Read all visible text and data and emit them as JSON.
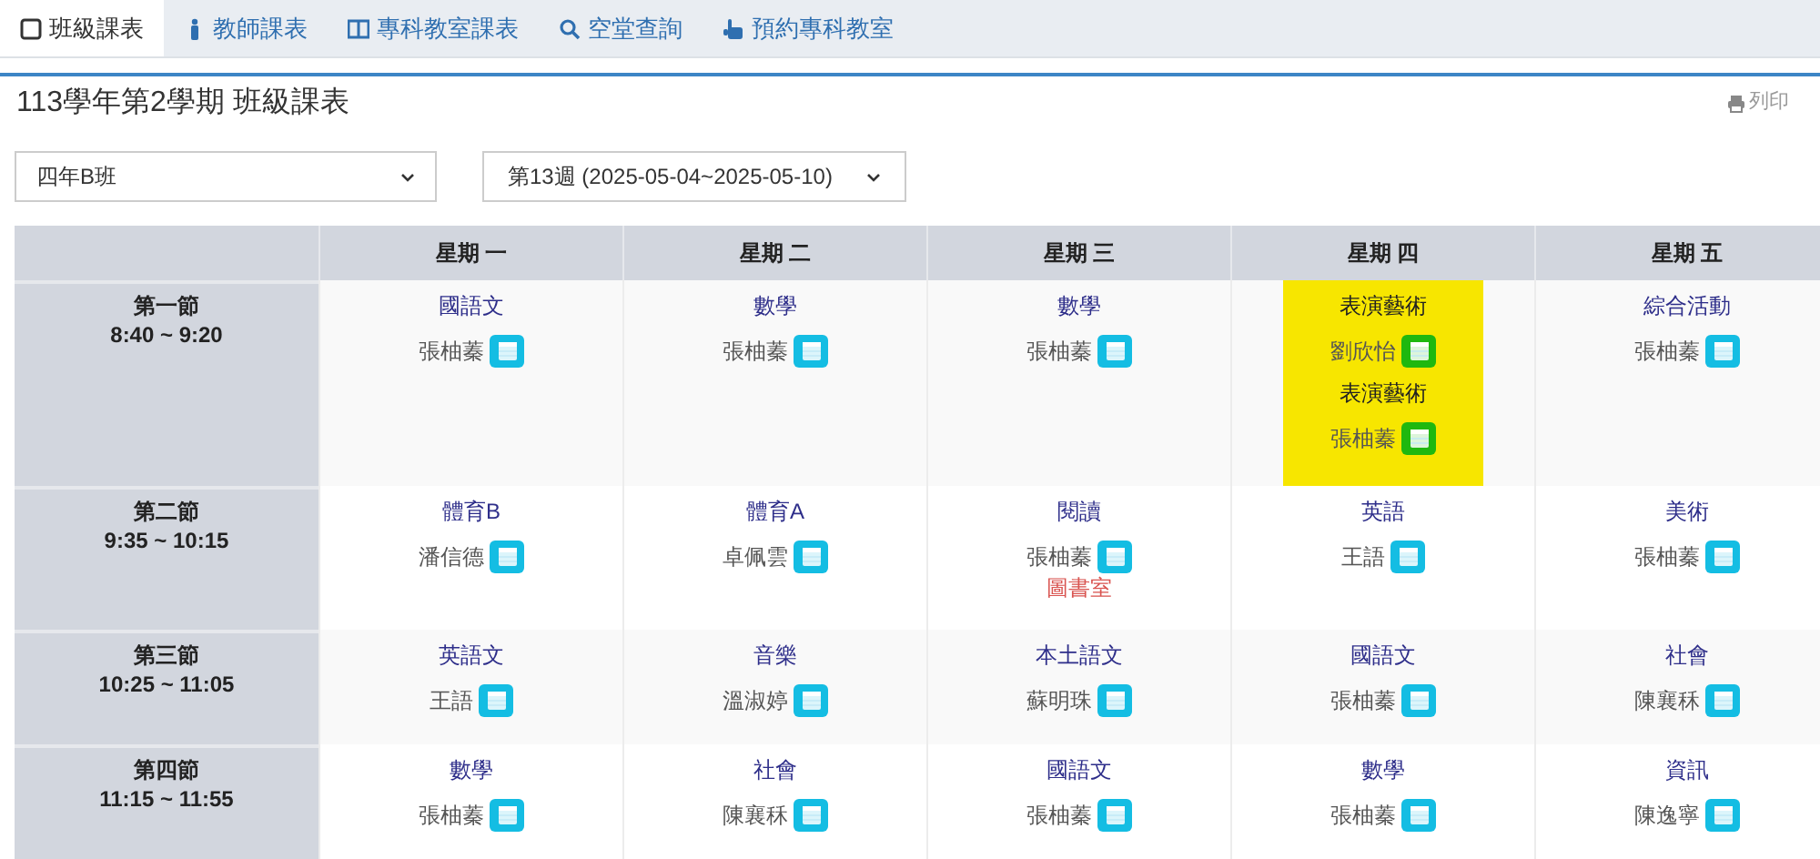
{
  "tabs": [
    {
      "label": "班級課表",
      "selected": true
    },
    {
      "label": "教師課表",
      "selected": false
    },
    {
      "label": "專科教室課表",
      "selected": false
    },
    {
      "label": "空堂查詢",
      "selected": false
    },
    {
      "label": "預約專科教室",
      "selected": false
    }
  ],
  "title": "113學年第2學期 班級課表",
  "print_button": "列印",
  "class_select": {
    "value": "四年B班"
  },
  "week_select": {
    "value": "第13週 (2025-05-04~2025-05-10)"
  },
  "table": {
    "columns": [
      "星期 一",
      "星期 二",
      "星期 三",
      "星期 四",
      "星期 五"
    ],
    "rows": [
      {
        "period": "第一節",
        "time": "8:40 ~ 9:20",
        "cells": [
          {
            "highlighted": false,
            "entries": [
              {
                "subject": "國語文",
                "teacher": "張柚蓁",
                "color": "#14bde3"
              }
            ]
          },
          {
            "highlighted": false,
            "entries": [
              {
                "subject": "數學",
                "teacher": "張柚蓁",
                "color": "#14bde3"
              }
            ]
          },
          {
            "highlighted": false,
            "entries": [
              {
                "subject": "數學",
                "teacher": "張柚蓁",
                "color": "#14bde3"
              }
            ]
          },
          {
            "highlighted": true,
            "entries": [
              {
                "subject": "表演藝術",
                "teacher": "劉欣怡",
                "color": "#1fb80f"
              },
              {
                "subject": "表演藝術",
                "teacher": "張柚蓁",
                "color": "#1fb80f"
              }
            ]
          },
          {
            "highlighted": false,
            "entries": [
              {
                "subject": "綜合活動",
                "teacher": "張柚蓁",
                "color": "#14bde3"
              }
            ]
          }
        ]
      },
      {
        "period": "第二節",
        "time": "9:35 ~ 10:15",
        "cells": [
          {
            "highlighted": false,
            "entries": [
              {
                "subject": "體育B",
                "teacher": "潘信德",
                "color": "#14bde3"
              }
            ]
          },
          {
            "highlighted": false,
            "entries": [
              {
                "subject": "體育A",
                "teacher": "卓佩雲",
                "color": "#14bde3"
              }
            ]
          },
          {
            "highlighted": false,
            "entries": [
              {
                "subject": "閱讀",
                "teacher": "張柚蓁",
                "color": "#14bde3",
                "room": "圖書室"
              }
            ]
          },
          {
            "highlighted": false,
            "entries": [
              {
                "subject": "英語",
                "teacher": "王語",
                "color": "#14bde3"
              }
            ]
          },
          {
            "highlighted": false,
            "entries": [
              {
                "subject": "美術",
                "teacher": "張柚蓁",
                "color": "#14bde3"
              }
            ]
          }
        ]
      },
      {
        "period": "第三節",
        "time": "10:25 ~ 11:05",
        "cells": [
          {
            "highlighted": false,
            "entries": [
              {
                "subject": "英語文",
                "teacher": "王語",
                "color": "#14bde3"
              }
            ]
          },
          {
            "highlighted": false,
            "entries": [
              {
                "subject": "音樂",
                "teacher": "溫淑婷",
                "color": "#14bde3"
              }
            ]
          },
          {
            "highlighted": false,
            "entries": [
              {
                "subject": "本土語文",
                "teacher": "蘇明珠",
                "color": "#14bde3"
              }
            ]
          },
          {
            "highlighted": false,
            "entries": [
              {
                "subject": "國語文",
                "teacher": "張柚蓁",
                "color": "#14bde3"
              }
            ]
          },
          {
            "highlighted": false,
            "entries": [
              {
                "subject": "社會",
                "teacher": "陳襄秝",
                "color": "#14bde3"
              }
            ]
          }
        ]
      },
      {
        "period": "第四節",
        "time": "11:15 ~ 11:55",
        "cells": [
          {
            "highlighted": false,
            "entries": [
              {
                "subject": "數學",
                "teacher": "張柚蓁",
                "color": "#14bde3"
              }
            ]
          },
          {
            "highlighted": false,
            "entries": [
              {
                "subject": "社會",
                "teacher": "陳襄秝",
                "color": "#14bde3"
              }
            ]
          },
          {
            "highlighted": false,
            "entries": [
              {
                "subject": "國語文",
                "teacher": "張柚蓁",
                "color": "#14bde3"
              }
            ]
          },
          {
            "highlighted": false,
            "entries": [
              {
                "subject": "數學",
                "teacher": "張柚蓁",
                "color": "#14bde3"
              }
            ]
          },
          {
            "highlighted": false,
            "entries": [
              {
                "subject": "資訊",
                "teacher": "陳逸寧",
                "color": "#14bde3"
              }
            ]
          }
        ]
      }
    ]
  }
}
